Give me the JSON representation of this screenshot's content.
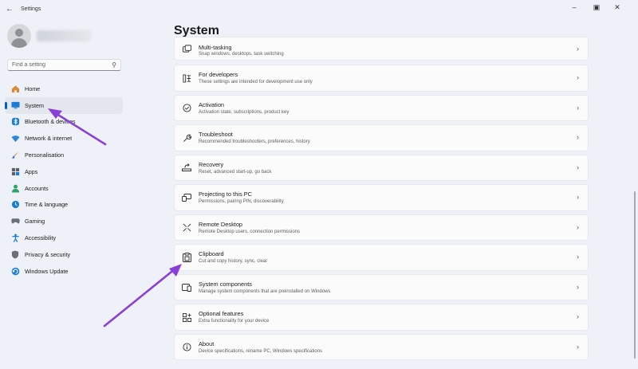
{
  "titlebar": {
    "back_icon": "back-arrow-icon",
    "title": "Settings",
    "minimize_icon": "minimize-icon",
    "maximize_icon": "maximize-icon",
    "close_icon": "close-icon"
  },
  "sidebar": {
    "search_placeholder": "Find a setting",
    "items": [
      {
        "label": "Home",
        "icon": "home-icon",
        "color": "#d88a3c"
      },
      {
        "label": "System",
        "icon": "monitor-icon",
        "color": "#1a7fd4"
      },
      {
        "label": "Bluetooth & devices",
        "icon": "bluetooth-icon",
        "color": "#1a7fd4"
      },
      {
        "label": "Network & internet",
        "icon": "wifi-icon",
        "color": "#2a8ad8"
      },
      {
        "label": "Personalisation",
        "icon": "brush-icon",
        "color": "#e07b3a"
      },
      {
        "label": "Apps",
        "icon": "apps-icon",
        "color": "#5a5f6b"
      },
      {
        "label": "Accounts",
        "icon": "person-icon",
        "color": "#2fa36b"
      },
      {
        "label": "Time & language",
        "icon": "globe-clock-icon",
        "color": "#1a7fd4"
      },
      {
        "label": "Gaming",
        "icon": "gamepad-icon",
        "color": "#6b6f78"
      },
      {
        "label": "Accessibility",
        "icon": "accessibility-icon",
        "color": "#1a7fd4"
      },
      {
        "label": "Privacy & security",
        "icon": "shield-icon",
        "color": "#6b6f78"
      },
      {
        "label": "Windows Update",
        "icon": "update-icon",
        "color": "#1a7fd4"
      }
    ],
    "active_index": 1
  },
  "main": {
    "title": "System",
    "cards": [
      {
        "title": "Multi-tasking",
        "subtitle": "Snap windows, desktops, task switching",
        "icon": "multitasking-icon"
      },
      {
        "title": "For developers",
        "subtitle": "These settings are intended for development use only",
        "icon": "developer-tools-icon"
      },
      {
        "title": "Activation",
        "subtitle": "Activation state, subscriptions, product key",
        "icon": "check-circle-icon"
      },
      {
        "title": "Troubleshoot",
        "subtitle": "Recommended troubleshooters, preferences, history",
        "icon": "wrench-icon"
      },
      {
        "title": "Recovery",
        "subtitle": "Reset, advanced start-up, go back",
        "icon": "recovery-icon"
      },
      {
        "title": "Projecting to this PC",
        "subtitle": "Permissions, pairing PIN, discoverability",
        "icon": "projector-icon"
      },
      {
        "title": "Remote Desktop",
        "subtitle": "Remote Desktop users, connection permissions",
        "icon": "remote-desktop-icon"
      },
      {
        "title": "Clipboard",
        "subtitle": "Cut and copy history, sync, clear",
        "icon": "clipboard-icon"
      },
      {
        "title": "System components",
        "subtitle": "Manage system components that are preinstalled on Windows",
        "icon": "components-icon"
      },
      {
        "title": "Optional features",
        "subtitle": "Extra functionality for your device",
        "icon": "optional-features-icon"
      },
      {
        "title": "About",
        "subtitle": "Device specifications, rename PC, Windows specifications",
        "icon": "info-icon"
      }
    ]
  },
  "annotations": {
    "arrow_color": "#8a3fd6"
  }
}
